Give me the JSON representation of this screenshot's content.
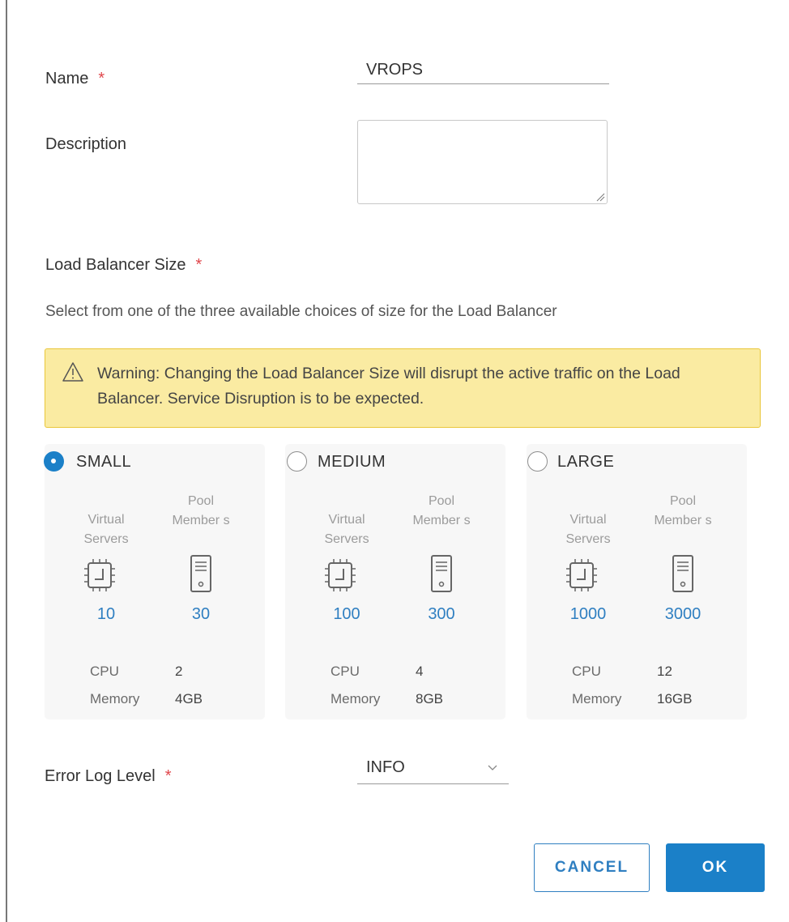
{
  "form": {
    "name_label": "Name",
    "name_value": "VROPS",
    "description_label": "Description",
    "description_value": "",
    "size_label": "Load Balancer Size",
    "size_hint": "Select from one of the three available choices of size for the Load Balancer",
    "required_mark": "*",
    "error_log_label": "Error Log Level",
    "error_log_value": "INFO"
  },
  "warning": {
    "text": "Warning: Changing the Load Balancer Size will disrupt the active traffic on the Load Balancer. Service Disruption is to be expected.",
    "color": "#faeba2"
  },
  "sizes": [
    {
      "label": "SMALL",
      "selected": true,
      "virtual_servers_label": "Virtual Servers",
      "pool_members_label": "Pool Member s",
      "virtual_servers": "10",
      "pool_members": "30",
      "cpu_label": "CPU",
      "cpu": "2",
      "memory_label": "Memory",
      "memory": "4GB"
    },
    {
      "label": "MEDIUM",
      "selected": false,
      "virtual_servers_label": "Virtual Servers",
      "pool_members_label": "Pool Member s",
      "virtual_servers": "100",
      "pool_members": "300",
      "cpu_label": "CPU",
      "cpu": "4",
      "memory_label": "Memory",
      "memory": "8GB"
    },
    {
      "label": "LARGE",
      "selected": false,
      "virtual_servers_label": "Virtual Servers",
      "pool_members_label": "Pool Member s",
      "virtual_servers": "1000",
      "pool_members": "3000",
      "cpu_label": "CPU",
      "cpu": "12",
      "memory_label": "Memory",
      "memory": "16GB"
    }
  ],
  "buttons": {
    "cancel": "CANCEL",
    "ok": "OK"
  },
  "icons": [
    "warning-icon",
    "chip-icon",
    "server-icon",
    "chevron-down-icon",
    "resize-handle-icon"
  ],
  "colors": {
    "accent": "#1b80c8",
    "required": "#e0464b",
    "value_blue": "#2f7fc1"
  }
}
